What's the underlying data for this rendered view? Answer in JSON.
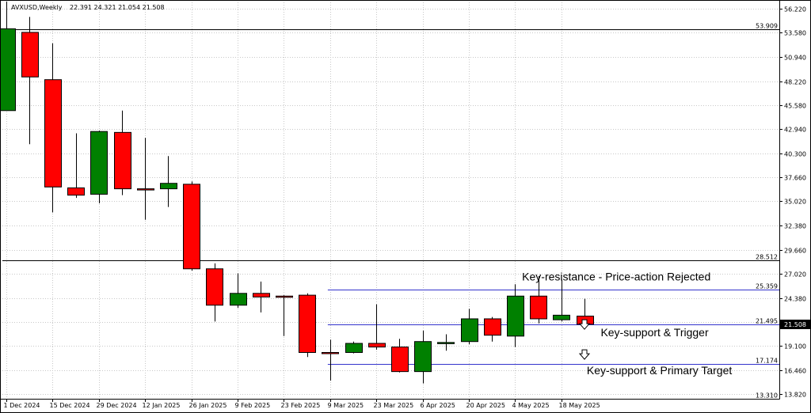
{
  "header": {
    "symbol": "AVXUSD,Weekly",
    "ohlc": "22.391 24.321 21.054 21.508"
  },
  "colors": {
    "bull": "#008000",
    "bear": "#ff0000",
    "blue_line": "#3333cc",
    "black_line": "#000000",
    "grid": "#c8c8c8"
  },
  "chart_data": {
    "type": "candlestick",
    "title": "",
    "xlabel": "",
    "ylabel": "",
    "ylim": [
      13.31,
      56.9
    ],
    "grid": true,
    "y_ticks": [
      "56.220",
      "53.580",
      "50.940",
      "48.220",
      "45.580",
      "42.940",
      "40.300",
      "37.660",
      "35.020",
      "32.380",
      "29.660",
      "27.020",
      "24.380",
      "21.740",
      "19.100",
      "16.460",
      "13.820"
    ],
    "x_ticks": [
      {
        "label": "1 Dec 2024",
        "index": 0
      },
      {
        "label": "15 Dec 2024",
        "index": 2
      },
      {
        "label": "29 Dec 2024",
        "index": 4
      },
      {
        "label": "12 Jan 2025",
        "index": 6
      },
      {
        "label": "26 Jan 2025",
        "index": 8
      },
      {
        "label": "9 Feb 2025",
        "index": 10
      },
      {
        "label": "23 Feb 2025",
        "index": 12
      },
      {
        "label": "9 Mar 2025",
        "index": 14
      },
      {
        "label": "23 Mar 2025",
        "index": 16
      },
      {
        "label": "6 Apr 2025",
        "index": 18
      },
      {
        "label": "20 Apr 2025",
        "index": 20
      },
      {
        "label": "4 May 2025",
        "index": 22
      },
      {
        "label": "18 May 2025",
        "index": 24
      }
    ],
    "candles": [
      {
        "o": 45.0,
        "h": 57.0,
        "l": 45.0,
        "c": 54.0
      },
      {
        "o": 53.6,
        "h": 55.3,
        "l": 41.3,
        "c": 48.7
      },
      {
        "o": 48.4,
        "h": 52.4,
        "l": 33.8,
        "c": 36.6
      },
      {
        "o": 36.5,
        "h": 42.5,
        "l": 35.4,
        "c": 35.7
      },
      {
        "o": 35.8,
        "h": 42.8,
        "l": 34.8,
        "c": 42.7
      },
      {
        "o": 42.6,
        "h": 45.0,
        "l": 35.7,
        "c": 36.4
      },
      {
        "o": 36.4,
        "h": 42.0,
        "l": 33.0,
        "c": 36.3
      },
      {
        "o": 36.4,
        "h": 40.0,
        "l": 34.4,
        "c": 37.0
      },
      {
        "o": 36.9,
        "h": 37.2,
        "l": 27.4,
        "c": 27.6
      },
      {
        "o": 27.6,
        "h": 28.2,
        "l": 21.8,
        "c": 23.6
      },
      {
        "o": 23.6,
        "h": 27.1,
        "l": 23.3,
        "c": 24.9
      },
      {
        "o": 24.9,
        "h": 26.2,
        "l": 22.8,
        "c": 24.5
      },
      {
        "o": 24.6,
        "h": 24.7,
        "l": 20.2,
        "c": 24.5
      },
      {
        "o": 24.7,
        "h": 24.9,
        "l": 17.9,
        "c": 18.4
      },
      {
        "o": 18.4,
        "h": 19.8,
        "l": 15.3,
        "c": 18.3
      },
      {
        "o": 18.4,
        "h": 19.6,
        "l": 18.3,
        "c": 19.4
      },
      {
        "o": 19.4,
        "h": 23.7,
        "l": 18.7,
        "c": 19.0
      },
      {
        "o": 19.0,
        "h": 19.9,
        "l": 16.2,
        "c": 16.3
      },
      {
        "o": 16.3,
        "h": 20.8,
        "l": 15.0,
        "c": 19.6
      },
      {
        "o": 19.4,
        "h": 20.4,
        "l": 18.6,
        "c": 19.5
      },
      {
        "o": 19.6,
        "h": 23.2,
        "l": 19.3,
        "c": 22.1
      },
      {
        "o": 22.1,
        "h": 22.3,
        "l": 19.6,
        "c": 20.3
      },
      {
        "o": 20.2,
        "h": 25.9,
        "l": 19.0,
        "c": 24.6
      },
      {
        "o": 24.6,
        "h": 26.8,
        "l": 21.6,
        "c": 22.1
      },
      {
        "o": 22.0,
        "h": 26.4,
        "l": 21.8,
        "c": 22.5
      },
      {
        "o": 22.4,
        "h": 24.3,
        "l": 21.1,
        "c": 21.5
      }
    ],
    "hlines": [
      {
        "value": 53.909,
        "label": "53.909",
        "color": "#000000",
        "full": true
      },
      {
        "value": 28.512,
        "label": "28.512",
        "color": "#000000",
        "full": true
      },
      {
        "value": 25.359,
        "label": "25.359",
        "color": "#3333cc",
        "full": false
      },
      {
        "value": 21.495,
        "label": "21.495",
        "color": "#3333cc",
        "full": false
      },
      {
        "value": 17.174,
        "label": "17.174",
        "color": "#3333cc",
        "full": false
      }
    ],
    "axis_extra_labels": [
      {
        "value": 13.31,
        "label": "13.310"
      }
    ],
    "current_price": {
      "value": 21.508,
      "label": "21.508"
    },
    "annotations": [
      {
        "text": "Key-resistance - Price-action Rejected",
        "value": 26.3,
        "index": 22.3
      },
      {
        "text": "Key-support & Trigger",
        "value": 20.2,
        "index": 25.7
      },
      {
        "text": "Key-support & Primary Target",
        "value": 16.0,
        "index": 25.1
      }
    ],
    "arrows": [
      {
        "index": 25.0,
        "value": 21.3
      },
      {
        "index": 25.0,
        "value": 18.0
      }
    ]
  }
}
